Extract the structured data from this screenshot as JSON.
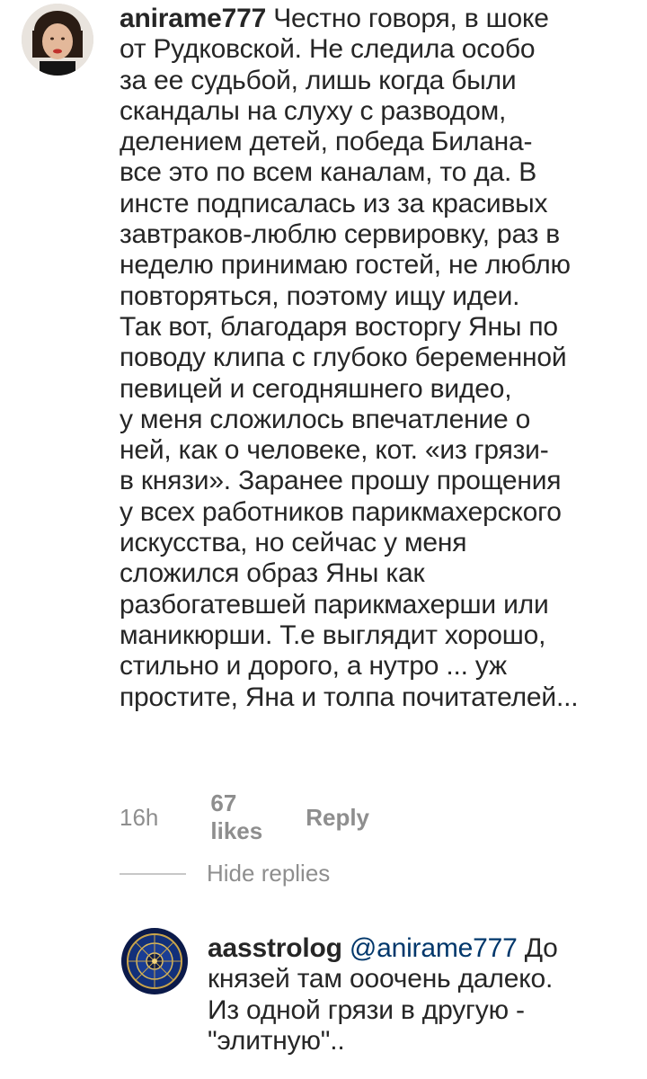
{
  "comment": {
    "username": "anirame777",
    "first_line_text": "Честно говоря, в шоке",
    "lines": [
      "от Рудковской. Не следила особо",
      "за ее судьбой, лишь когда были",
      "скандалы на слуху с разводом,",
      "делением детей, победа Билана-",
      "все это по всем каналам, то да. В",
      "инсте подписалась из за красивых",
      "завтраков-люблю сервировку, раз в",
      "неделю принимаю гостей, не люблю",
      "повторяться, поэтому ищу идеи.",
      "Так вот, благодаря восторгу Яны по",
      "поводу клипа с глубоко беременной",
      "певицей и сегодняшнего видео,",
      "у меня сложилось впечатление о",
      "ней, как о человеке, кот. «из грязи-",
      "в князи». Заранее прошу прощения",
      "у всех работников парикмахерского",
      "искусства, но сейчас у меня",
      "сложился образ Яны как",
      "разбогатевшей парикмахерши или",
      "маникюрши. Т.е выглядит хорошо,",
      "стильно и дорого, а нутро ... уж",
      "простите, Яна и толпа почитателей..."
    ],
    "time": "16h",
    "likes": "67 likes",
    "reply_label": "Reply"
  },
  "hide_replies_label": "Hide replies",
  "reply": {
    "username": "aasstrolog",
    "mention": "@anirame777",
    "first_line_text": "До",
    "lines": [
      "князей там ооочень далеко.",
      "Из одной грязи в другую -",
      "\"элитную\".."
    ]
  },
  "colors": {
    "text": "#262626",
    "meta": "#8e8e8e",
    "mention": "#00376b",
    "divider": "#c7c7c7"
  }
}
